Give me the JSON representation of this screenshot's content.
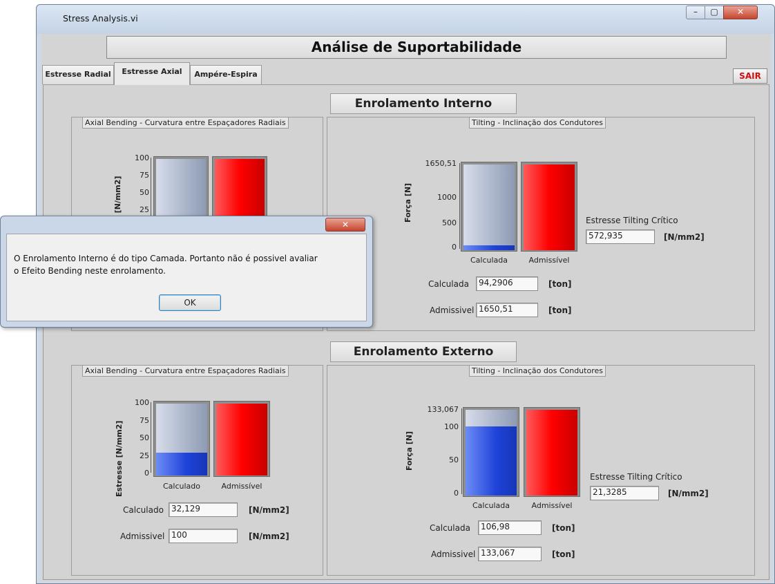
{
  "window": {
    "title": "Stress Analysis.vi",
    "min_label": "–",
    "max_label": "▢",
    "close_label": "✕"
  },
  "banner": "Análise de Suportabilidade",
  "tabs": [
    {
      "label": "Estresse Radial",
      "active": false
    },
    {
      "label": "Estresse Axial",
      "active": true
    },
    {
      "label": "Ampére-Espira",
      "active": false
    }
  ],
  "exit_button": "SAIR",
  "internal": {
    "section_label": "Enrolamento Interno",
    "bending": {
      "group_title": "Axial Bending - Curvatura entre Espaçadores Radiais",
      "y_label": "Estresse [N/mm2]",
      "ticks": [
        "100",
        "75",
        "50",
        "25"
      ]
    },
    "tilting": {
      "group_title": "Tilting - Inclinação dos Condutores",
      "y_label": "Força [N]",
      "ticks": [
        "1650,51",
        "1000",
        "500",
        "0"
      ],
      "bar1_label": "Calculada",
      "bar2_label": "Admissível",
      "calc_label": "Calculada",
      "calc_value": "94,2906",
      "calc_unit": "[ton]",
      "adm_label": "Admissivel",
      "adm_value": "1650,51",
      "adm_unit": "[ton]",
      "crit_label": "Estresse Tilting Crítico",
      "crit_value": "572,935",
      "crit_unit": "[N/mm2]",
      "calc_fraction": 0.057
    }
  },
  "external": {
    "section_label": "Enrolamento Externo",
    "bending": {
      "group_title": "Axial Bending - Curvatura entre Espaçadores Radiais",
      "y_label": "Estresse [N/mm2]",
      "ticks": [
        "100",
        "75",
        "50",
        "25",
        "0"
      ],
      "bar1_label": "Calculado",
      "bar2_label": "Admissível",
      "calc_label": "Calculado",
      "calc_value": "32,129",
      "calc_unit": "[N/mm2]",
      "adm_label": "Admissivel",
      "adm_value": "100",
      "adm_unit": "[N/mm2]",
      "calc_fraction": 0.32129
    },
    "tilting": {
      "group_title": "Tilting - Inclinação dos Condutores",
      "y_label": "Força [N]",
      "ticks": [
        "133,067",
        "100",
        "50",
        "0"
      ],
      "bar1_label": "Calculada",
      "bar2_label": "Admissível",
      "calc_label": "Calculada",
      "calc_value": "106,98",
      "calc_unit": "[ton]",
      "adm_label": "Admissivel",
      "adm_value": "133,067",
      "adm_unit": "[ton]",
      "crit_label": "Estresse Tilting Crítico",
      "crit_value": "21,3285",
      "crit_unit": "[N/mm2]",
      "calc_fraction": 0.804
    }
  },
  "dialog": {
    "close_label": "✕",
    "message_line1": "O Enrolamento Interno é do tipo Camada. Portanto não é possivel avaliar",
    "message_line2": "o Efeito Bending neste enrolamento.",
    "ok_label": "OK"
  }
}
